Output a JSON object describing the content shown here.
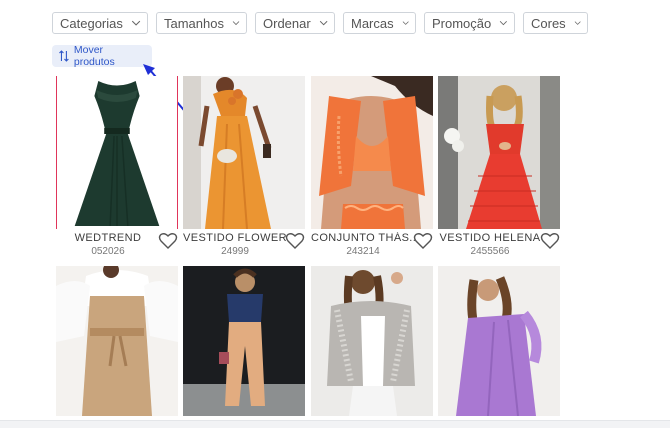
{
  "filters": [
    {
      "label": "Categorias"
    },
    {
      "label": "Tamanhos"
    },
    {
      "label": "Ordenar"
    },
    {
      "label": "Marcas"
    },
    {
      "label": "Promoção"
    },
    {
      "label": "Cores"
    }
  ],
  "move_button": {
    "label": "Mover produtos",
    "icon": "sort-arrows-icon"
  },
  "accent_color": "#2f57c8",
  "products": [
    {
      "name": "WEDTREND",
      "code": "052026",
      "icon": "heart-icon",
      "color": "#1f3a30"
    },
    {
      "name": "VESTIDO FLOWER",
      "code": "24999",
      "icon": "heart-icon",
      "color": "#e8902e"
    },
    {
      "name": "CONJUNTO THÁS...",
      "code": "243214",
      "icon": "heart-icon",
      "color": "#f07a3a"
    },
    {
      "name": "VESTIDO HELENA",
      "code": "2455566",
      "icon": "heart-icon",
      "color": "#e4322b"
    },
    {
      "name": "",
      "code": "",
      "icon": "",
      "color": "#c8a57a"
    },
    {
      "name": "",
      "code": "",
      "icon": "",
      "color": "#d9a77c"
    },
    {
      "name": "",
      "code": "",
      "icon": "",
      "color": "#b9b9b9"
    },
    {
      "name": "",
      "code": "",
      "icon": "",
      "color": "#a77fd0"
    }
  ]
}
